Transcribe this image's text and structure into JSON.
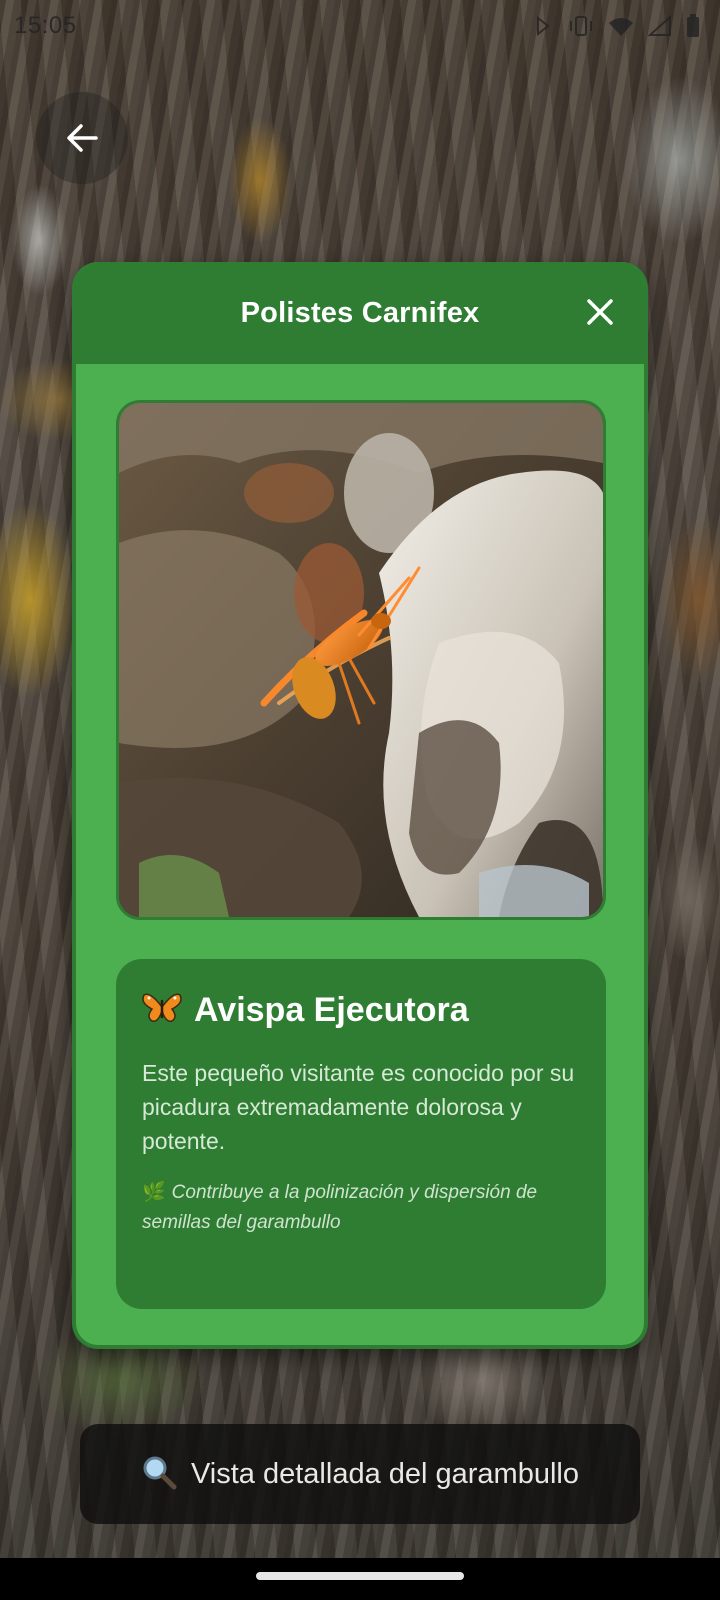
{
  "status_bar": {
    "time": "15:05",
    "icons": [
      "nfc-icon",
      "vibrate-icon",
      "wifi-icon",
      "signal-icon",
      "battery-icon"
    ]
  },
  "navigation": {
    "back_icon": "arrow-left-icon"
  },
  "dialog": {
    "title": "Polistes Carnifex",
    "close_icon": "close-icon",
    "header_color": "#2e7d32",
    "body_color": "#4caf50",
    "info": {
      "emoji_icon": "butterfly-icon",
      "title": "Avispa Ejecutora",
      "description": "Este pequeño visitante es conocido por su picadura extremadamente dolorosa y potente.",
      "note_icon": "leaf-icon",
      "note": "Contribuye a la polinización y dispersión de semillas del garambullo"
    }
  },
  "bottom_banner": {
    "icon": "magnifier-icon",
    "text": "Vista detallada del garambullo"
  }
}
